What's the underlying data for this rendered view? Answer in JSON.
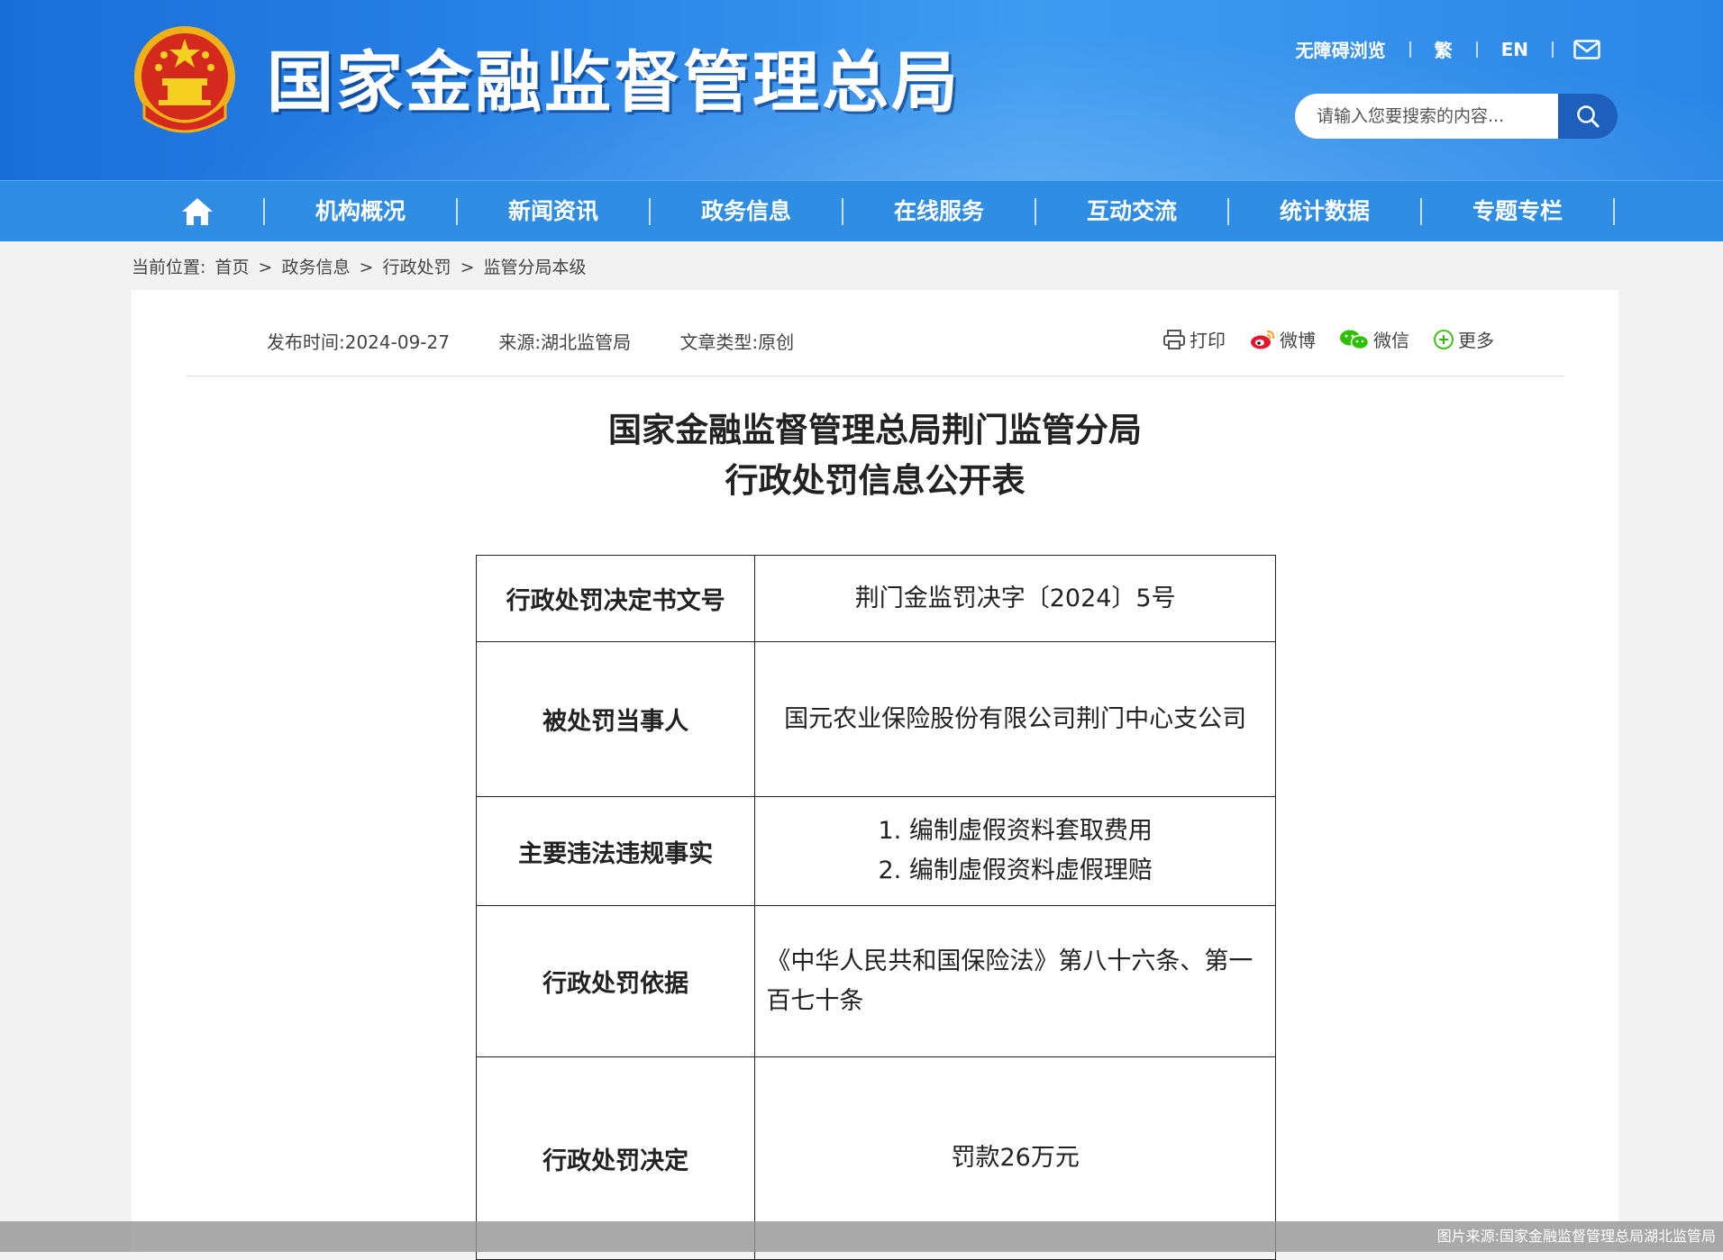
{
  "header": {
    "site_title": "国家金融监督管理总局",
    "top_links": [
      "无障碍浏览",
      "繁",
      "EN"
    ],
    "search_placeholder": "请输入您要搜索的内容..."
  },
  "nav": {
    "items": [
      "机构概况",
      "新闻资讯",
      "政务信息",
      "在线服务",
      "互动交流",
      "统计数据",
      "专题专栏"
    ]
  },
  "breadcrumb": {
    "label": "当前位置:",
    "items": [
      "首页",
      "政务信息",
      "行政处罚",
      "监管分局本级"
    ],
    "separator": ">"
  },
  "meta": {
    "publish_time": "发布时间:2024-09-27",
    "source": "来源:湖北监管局",
    "type": "文章类型:原创"
  },
  "share": {
    "print": "打印",
    "weibo": "微博",
    "wechat": "微信",
    "more": "更多"
  },
  "document": {
    "title_line1": "国家金融监督管理总局荆门监管分局",
    "title_line2": "行政处罚信息公开表",
    "rows": [
      {
        "key": "行政处罚决定书文号",
        "value": "荆门金监罚决字〔2024〕5号"
      },
      {
        "key": "被处罚当事人",
        "value": "国元农业保险股份有限公司荆门中心支公司"
      },
      {
        "key": "主要违法违规事实",
        "value_lines": [
          "1. 编制虚假资料套取费用",
          "2. 编制虚假资料虚假理赔"
        ]
      },
      {
        "key": "行政处罚依据",
        "value": "《中华人民共和国保险法》第八十六条、第一百七十条"
      },
      {
        "key": "行政处罚决定",
        "value": "罚款26万元"
      }
    ]
  },
  "caption": "图片来源:国家金融监督管理总局湖北监管局",
  "colors": {
    "header_blue": "#2b86e8",
    "nav_blue": "#2f8de4",
    "search_button": "#1e5fbe",
    "emblem_red": "#d42a1e",
    "emblem_gold": "#f5c21a"
  }
}
